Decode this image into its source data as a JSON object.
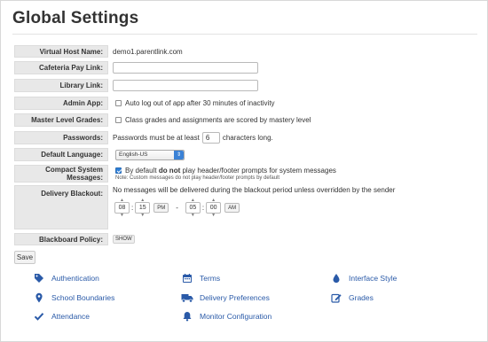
{
  "page": {
    "title": "Global Settings"
  },
  "form": {
    "virtual_host": {
      "label": "Virtual Host Name:",
      "value": "demo1.parentlink.com"
    },
    "cafeteria": {
      "label": "Cafeteria Pay Link:",
      "value": ""
    },
    "library": {
      "label": "Library Link:",
      "value": ""
    },
    "admin_app": {
      "label": "Admin App:",
      "checked": false,
      "text": "Auto log out of app after 30 minutes of inactivity"
    },
    "master_grades": {
      "label": "Master Level Grades:",
      "checked": false,
      "text": "Class grades and assignments are scored by mastery level"
    },
    "passwords": {
      "label": "Passwords:",
      "prefix": "Passwords must be at least",
      "min_length": "6",
      "suffix": "characters long."
    },
    "language": {
      "label": "Default Language:",
      "selected": "English-US"
    },
    "compact": {
      "label": "Compact System Messages:",
      "checked": true,
      "text_before": "By default",
      "text_bold": "do not",
      "text_after": "play header/footer prompts for system messages",
      "note": "Note: Custom messages do not play header/footer prompts by default"
    },
    "blackout": {
      "label": "Delivery Blackout:",
      "text": "No messages will be delivered during the blackout period unless overridden by the sender",
      "start": {
        "hour": "08",
        "minute": "15",
        "ampm": "PM"
      },
      "separator": "-",
      "end": {
        "hour": "05",
        "minute": "00",
        "ampm": "AM"
      }
    },
    "blackboard": {
      "label": "Blackboard Policy:",
      "button": "SHOW"
    },
    "save_label": "Save"
  },
  "links": [
    {
      "label": "Authentication",
      "icon": "tag-icon"
    },
    {
      "label": "Terms",
      "icon": "calendar-icon"
    },
    {
      "label": "Interface Style",
      "icon": "droplet-icon"
    },
    {
      "label": "School Boundaries",
      "icon": "map-pin-icon"
    },
    {
      "label": "Delivery Preferences",
      "icon": "truck-icon"
    },
    {
      "label": "Grades",
      "icon": "edit-icon"
    },
    {
      "label": "Attendance",
      "icon": "check-icon"
    },
    {
      "label": "Monitor Configuration",
      "icon": "bell-icon"
    }
  ],
  "colors": {
    "link": "#2a5aa8",
    "label_bg": "#e8e8e8",
    "checkbox_on": "#2d7ed6"
  }
}
